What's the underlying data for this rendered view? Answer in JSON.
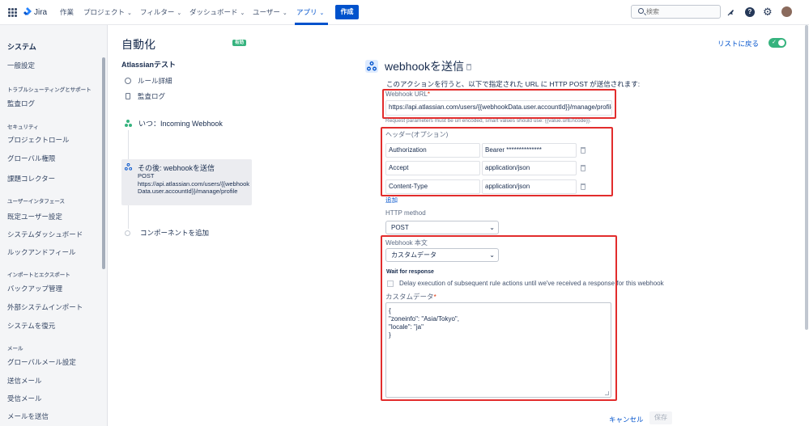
{
  "app": {
    "name": "Jira"
  },
  "nav": {
    "items": [
      {
        "label": "作業",
        "chevron": false
      },
      {
        "label": "プロジェクト",
        "chevron": true
      },
      {
        "label": "フィルター",
        "chevron": true
      },
      {
        "label": "ダッシュボード",
        "chevron": true
      },
      {
        "label": "ユーザー",
        "chevron": true
      },
      {
        "label": "アプリ",
        "chevron": true,
        "active": true
      }
    ],
    "create_label": "作成",
    "search_placeholder": "検索",
    "icons": [
      "notifications-icon",
      "help-icon",
      "settings-icon",
      "avatar"
    ]
  },
  "sidebar": {
    "title": "システム",
    "items": [
      {
        "type": "item",
        "label": "一般設定"
      },
      {
        "type": "section",
        "label": "トラブルシューティングとサポート"
      },
      {
        "type": "item",
        "label": "監査ログ"
      },
      {
        "type": "section",
        "label": "セキュリティ"
      },
      {
        "type": "item",
        "label": "プロジェクトロール"
      },
      {
        "type": "item",
        "label": "グローバル権限"
      },
      {
        "type": "item",
        "label": "課題コレクター"
      },
      {
        "type": "section",
        "label": "ユーザーインタフェース"
      },
      {
        "type": "item",
        "label": "既定ユーザー設定"
      },
      {
        "type": "item",
        "label": "システムダッシュボード"
      },
      {
        "type": "item",
        "label": "ルックアンドフィール"
      },
      {
        "type": "section",
        "label": "インポートとエクスポート"
      },
      {
        "type": "item",
        "label": "バックアップ管理"
      },
      {
        "type": "item",
        "label": "外部システムインポート"
      },
      {
        "type": "item",
        "label": "システムを復元"
      },
      {
        "type": "section",
        "label": "メール"
      },
      {
        "type": "item",
        "label": "グローバルメール設定"
      },
      {
        "type": "item",
        "label": "送信メール"
      },
      {
        "type": "item",
        "label": "受信メール"
      },
      {
        "type": "item",
        "label": "メールを送信"
      }
    ]
  },
  "rule": {
    "page_title": "自動化",
    "status_badge": "有効",
    "name": "Atlassianテスト",
    "links": [
      "ルール詳細",
      "監査ログ"
    ],
    "trigger_label": "いつ：Incoming Webhook",
    "action": {
      "title": "その後: webhookを送信",
      "method": "POST",
      "url": "https://api.atlassian.com/users/{{webhookData.user.accountId}}/manage/profile"
    },
    "add_component": "コンポーネントを追加"
  },
  "header_right": {
    "back_label": "リストに戻る",
    "toggle_on": true,
    "toggle_check": "✓"
  },
  "config": {
    "title": "webhookを送信",
    "description": "このアクションを行うと、以下で指定された URL に HTTP POST が送信されます:",
    "url_label": "Webhook URL",
    "url_required": "*",
    "url_value": "https://api.atlassian.com/users/{{webhookData.user.accountId}}/manage/profile",
    "url_hint": "Request parameters must be url encoded, smart values should use: {{value.urlEncode}}.",
    "headers_label": "ヘッダー(オプション)",
    "headers": [
      {
        "name": "Authorization",
        "value": "Bearer **************"
      },
      {
        "name": "Accept",
        "value": "application/json"
      },
      {
        "name": "Content-Type",
        "value": "application/json"
      }
    ],
    "add_label": "追加",
    "http_method_label": "HTTP method",
    "http_method_value": "POST",
    "body_label": "Webhook 本文",
    "body_value": "カスタムデータ",
    "wait_label": "Wait for response",
    "wait_checkbox_label": "Delay execution of subsequent rule actions until we've received a response for this webhook",
    "wait_checked": false,
    "custom_data_label": "カスタムデータ",
    "custom_data_required": "*",
    "custom_data_lines": [
      "{",
      "\"zoneinfo\": \"Asia/Tokyo\",",
      "\"locale\": \"ja\"",
      "}"
    ]
  },
  "footer": {
    "cancel_label": "キャンセル",
    "save_label": "保存"
  },
  "colors": {
    "accent": "#0052cc",
    "success": "#36b37e",
    "highlight": "#e22d2d"
  }
}
